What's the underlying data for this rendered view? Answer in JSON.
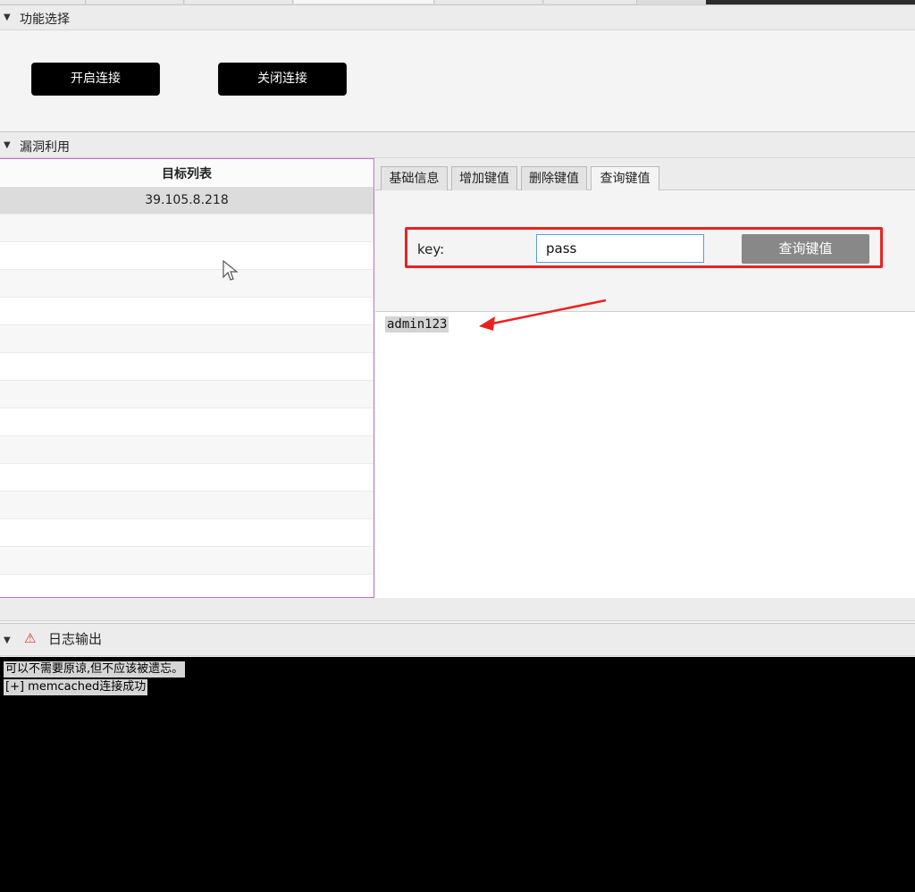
{
  "sections": {
    "function_select": {
      "title": "功能选择",
      "open_button": "开启连接",
      "close_button": "关闭连接"
    },
    "exploit": {
      "title": "漏洞利用",
      "target_list_header": "目标列表",
      "targets": [
        "39.105.8.218"
      ],
      "tabs": [
        {
          "label": "基础信息"
        },
        {
          "label": "增加键值"
        },
        {
          "label": "删除键值"
        },
        {
          "label": "查询键值"
        }
      ],
      "active_tab": "查询键值",
      "query": {
        "key_label": "key:",
        "key_value": "pass",
        "button_label": "查询键值",
        "result": "admin123"
      }
    },
    "log": {
      "title": "日志输出",
      "lines": [
        "可以不需要原谅,但不应该被遗忘。",
        "[+] memcached连接成功"
      ]
    }
  },
  "icons": {
    "collapse_arrow": "triangle-down-icon",
    "warning": "warning-icon"
  },
  "colors": {
    "highlight_border": "#e8231f",
    "panel_border": "#c86bcc",
    "input_focus": "#4fa2e6"
  }
}
